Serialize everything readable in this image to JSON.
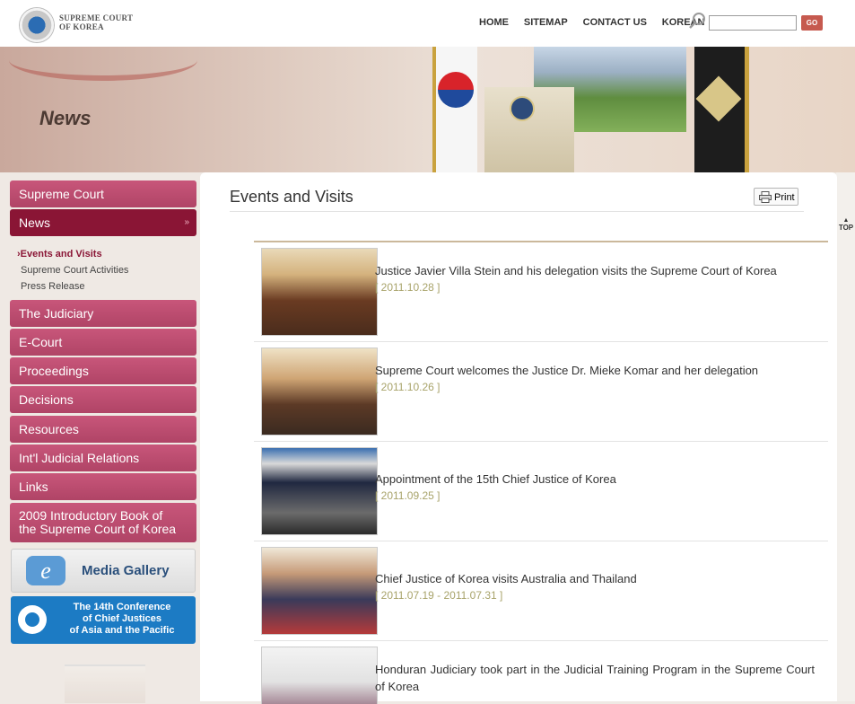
{
  "header": {
    "logo_text_line1": "SUPREME COURT",
    "logo_text_line2": "OF KOREA",
    "nav": [
      "HOME",
      "SITEMAP",
      "CONTACT US",
      "KOREAN"
    ],
    "search_placeholder": "",
    "go_label": "GO"
  },
  "banner": {
    "title": "News"
  },
  "sidebar": {
    "items": [
      {
        "label": "Supreme Court"
      },
      {
        "label": "News",
        "active": true
      },
      {
        "label": "The Judiciary"
      },
      {
        "label": "E-Court"
      },
      {
        "label": "Proceedings"
      },
      {
        "label": "Decisions"
      },
      {
        "label": "Resources"
      },
      {
        "label": "Int'l Judicial Relations"
      },
      {
        "label": "Links"
      },
      {
        "label_line1": "2009 Introductory Book of",
        "label_line2": "the Supreme Court of Korea"
      }
    ],
    "subitems": [
      "Events and Visits",
      "Supreme Court Activities",
      "Press Release"
    ]
  },
  "promos": {
    "gallery_label": "Media Gallery",
    "conference_line1": "The 14th Conference",
    "conference_line2": "of Chief Justices",
    "conference_line3": "of Asia and the Pacific"
  },
  "right_rail": {
    "top_label": "TOP"
  },
  "content": {
    "title": "Events and Visits",
    "print_label": "Print",
    "items": [
      {
        "title": "Justice Javier Villa Stein and his delegation visits the Supreme Court of Korea",
        "date": "[ 2011.10.28 ]"
      },
      {
        "title": "Supreme Court welcomes the Justice Dr. Mieke Komar and her delegation",
        "date": "[ 2011.10.26 ]"
      },
      {
        "title": "Appointment of the 15th Chief Justice of Korea",
        "date": "[ 2011.09.25 ]"
      },
      {
        "title": "Chief Justice of Korea visits Australia and Thailand",
        "date": "[ 2011.07.19 - 2011.07.31 ]"
      },
      {
        "title": "Honduran Judiciary took part in the Judicial Training Program in the Supreme Court of Korea",
        "date": ""
      }
    ]
  }
}
